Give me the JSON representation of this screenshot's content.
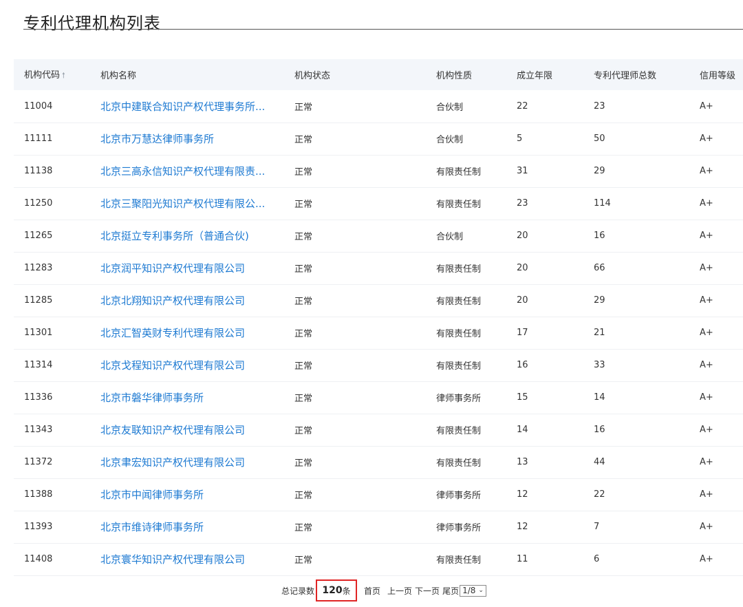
{
  "page": {
    "title": "专利代理机构列表"
  },
  "table": {
    "headers": {
      "code": "机构代码",
      "name": "机构名称",
      "status": "机构状态",
      "nature": "机构性质",
      "years": "成立年限",
      "count": "专利代理师总数",
      "credit": "信用等级"
    },
    "sort_icon": "arrow-up-icon",
    "rows": [
      {
        "code": "11004",
        "name": "北京中建联合知识产权代理事务所...",
        "status": "正常",
        "nature": "合伙制",
        "years": "22",
        "count": "23",
        "credit": "A+"
      },
      {
        "code": "11111",
        "name": "北京市万慧达律师事务所",
        "status": "正常",
        "nature": "合伙制",
        "years": "5",
        "count": "50",
        "credit": "A+"
      },
      {
        "code": "11138",
        "name": "北京三高永信知识产权代理有限责...",
        "status": "正常",
        "nature": "有限责任制",
        "years": "31",
        "count": "29",
        "credit": "A+"
      },
      {
        "code": "11250",
        "name": "北京三聚阳光知识产权代理有限公...",
        "status": "正常",
        "nature": "有限责任制",
        "years": "23",
        "count": "114",
        "credit": "A+"
      },
      {
        "code": "11265",
        "name": "北京挺立专利事务所（普通合伙)",
        "status": "正常",
        "nature": "合伙制",
        "years": "20",
        "count": "16",
        "credit": "A+"
      },
      {
        "code": "11283",
        "name": "北京润平知识产权代理有限公司",
        "status": "正常",
        "nature": "有限责任制",
        "years": "20",
        "count": "66",
        "credit": "A+"
      },
      {
        "code": "11285",
        "name": "北京北翔知识产权代理有限公司",
        "status": "正常",
        "nature": "有限责任制",
        "years": "20",
        "count": "29",
        "credit": "A+"
      },
      {
        "code": "11301",
        "name": "北京汇智英财专利代理有限公司",
        "status": "正常",
        "nature": "有限责任制",
        "years": "17",
        "count": "21",
        "credit": "A+"
      },
      {
        "code": "11314",
        "name": "北京戈程知识产权代理有限公司",
        "status": "正常",
        "nature": "有限责任制",
        "years": "16",
        "count": "33",
        "credit": "A+"
      },
      {
        "code": "11336",
        "name": "北京市磐华律师事务所",
        "status": "正常",
        "nature": "律师事务所",
        "years": "15",
        "count": "14",
        "credit": "A+"
      },
      {
        "code": "11343",
        "name": "北京友联知识产权代理有限公司",
        "status": "正常",
        "nature": "有限责任制",
        "years": "14",
        "count": "16",
        "credit": "A+"
      },
      {
        "code": "11372",
        "name": "北京聿宏知识产权代理有限公司",
        "status": "正常",
        "nature": "有限责任制",
        "years": "13",
        "count": "44",
        "credit": "A+"
      },
      {
        "code": "11388",
        "name": "北京市中闻律师事务所",
        "status": "正常",
        "nature": "律师事务所",
        "years": "12",
        "count": "22",
        "credit": "A+"
      },
      {
        "code": "11393",
        "name": "北京市维诗律师事务所",
        "status": "正常",
        "nature": "律师事务所",
        "years": "12",
        "count": "7",
        "credit": "A+"
      },
      {
        "code": "11408",
        "name": "北京寰华知识产权代理有限公司",
        "status": "正常",
        "nature": "有限责任制",
        "years": "11",
        "count": "6",
        "credit": "A+"
      }
    ]
  },
  "pager": {
    "total_label": "总记录数",
    "total_count": "120",
    "total_unit": "条",
    "first": "首页",
    "prev": "上一页",
    "next": "下一页",
    "last": "尾页",
    "page_select_value": "1/8",
    "highlight_color": "#e02424"
  },
  "colors": {
    "link": "#1e7ad2",
    "header_bg": "#f3f6fa"
  }
}
